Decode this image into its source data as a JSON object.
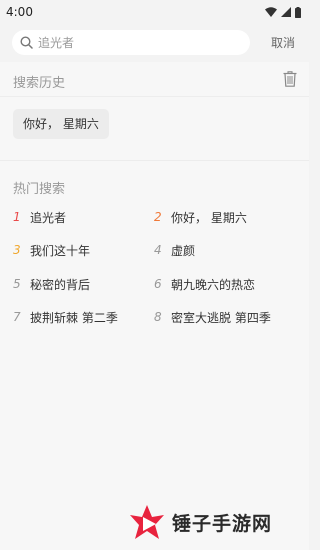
{
  "status_bar": {
    "time": "4:00"
  },
  "search": {
    "placeholder": "追光者",
    "cancel_label": "取消"
  },
  "history": {
    "title": "搜索历史",
    "items": [
      "你好， 星期六"
    ]
  },
  "hot": {
    "title": "热门搜索",
    "items": [
      {
        "rank": "1",
        "label": "追光者",
        "color": "#e94a4a"
      },
      {
        "rank": "2",
        "label": "你好， 星期六",
        "color": "#f07a3a"
      },
      {
        "rank": "3",
        "label": "我们这十年",
        "color": "#f0a830"
      },
      {
        "rank": "4",
        "label": "虚颜",
        "color": "#999999"
      },
      {
        "rank": "5",
        "label": "秘密的背后",
        "color": "#999999"
      },
      {
        "rank": "6",
        "label": "朝九晚六的热恋",
        "color": "#999999"
      },
      {
        "rank": "7",
        "label": "披荆斩棘 第二季",
        "color": "#999999"
      },
      {
        "rank": "8",
        "label": "密室大逃脱 第四季",
        "color": "#999999"
      }
    ]
  },
  "watermark": {
    "text": "锤子手游网"
  },
  "colors": {
    "accent": "#e8233e",
    "background": "#f3f3f3"
  }
}
